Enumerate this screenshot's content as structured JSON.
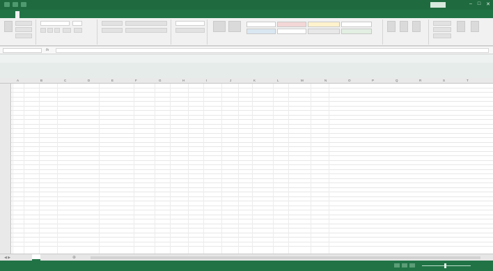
{
  "window": {
    "title": "",
    "signin": "",
    "controls": [
      "–",
      "□",
      "✕"
    ]
  },
  "ribbon_tabs": [
    "",
    "",
    "",
    "",
    "",
    "",
    "",
    "",
    "",
    "",
    ""
  ],
  "share_label": "",
  "ribbon": {
    "style_cells": [
      {
        "label": "",
        "bg": "#ffffff"
      },
      {
        "label": "",
        "bg": "#f3d6d6"
      },
      {
        "label": "",
        "bg": "#fff2cc"
      },
      {
        "label": "",
        "bg": "#ffffff"
      },
      {
        "label": "",
        "bg": "#d9e7f2"
      },
      {
        "label": "",
        "bg": "#ffffff"
      },
      {
        "label": "",
        "bg": "#e8e8e8"
      },
      {
        "label": "",
        "bg": "#e2efe2"
      }
    ],
    "group_labels": [
      "",
      "",
      "",
      "",
      "",
      "",
      ""
    ]
  },
  "formula_bar": {
    "name_box": "",
    "fx_label": "fx",
    "content": ""
  },
  "sheet": {
    "column_headers": [
      "A",
      "B",
      "C",
      "D",
      "E",
      "F",
      "G",
      "H",
      "I",
      "J",
      "K",
      "L",
      "M",
      "N",
      "O",
      "P",
      "Q",
      "R",
      "S",
      "T"
    ],
    "header_row": [
      "",
      "",
      "",
      "",
      "",
      "",
      "",
      "",
      "",
      "",
      "",
      "",
      "",
      "",
      "",
      "",
      ""
    ],
    "rows": [
      [
        "",
        "",
        "",
        "",
        "",
        "",
        "",
        "",
        "",
        "",
        "",
        "",
        "",
        "",
        "",
        "",
        ""
      ]
    ]
  },
  "sheet_tabs": [
    ""
  ],
  "status": {
    "ready": "",
    "zoom": ""
  },
  "colors": {
    "accent": "#217346",
    "titlebar": "#1f6b3f"
  }
}
